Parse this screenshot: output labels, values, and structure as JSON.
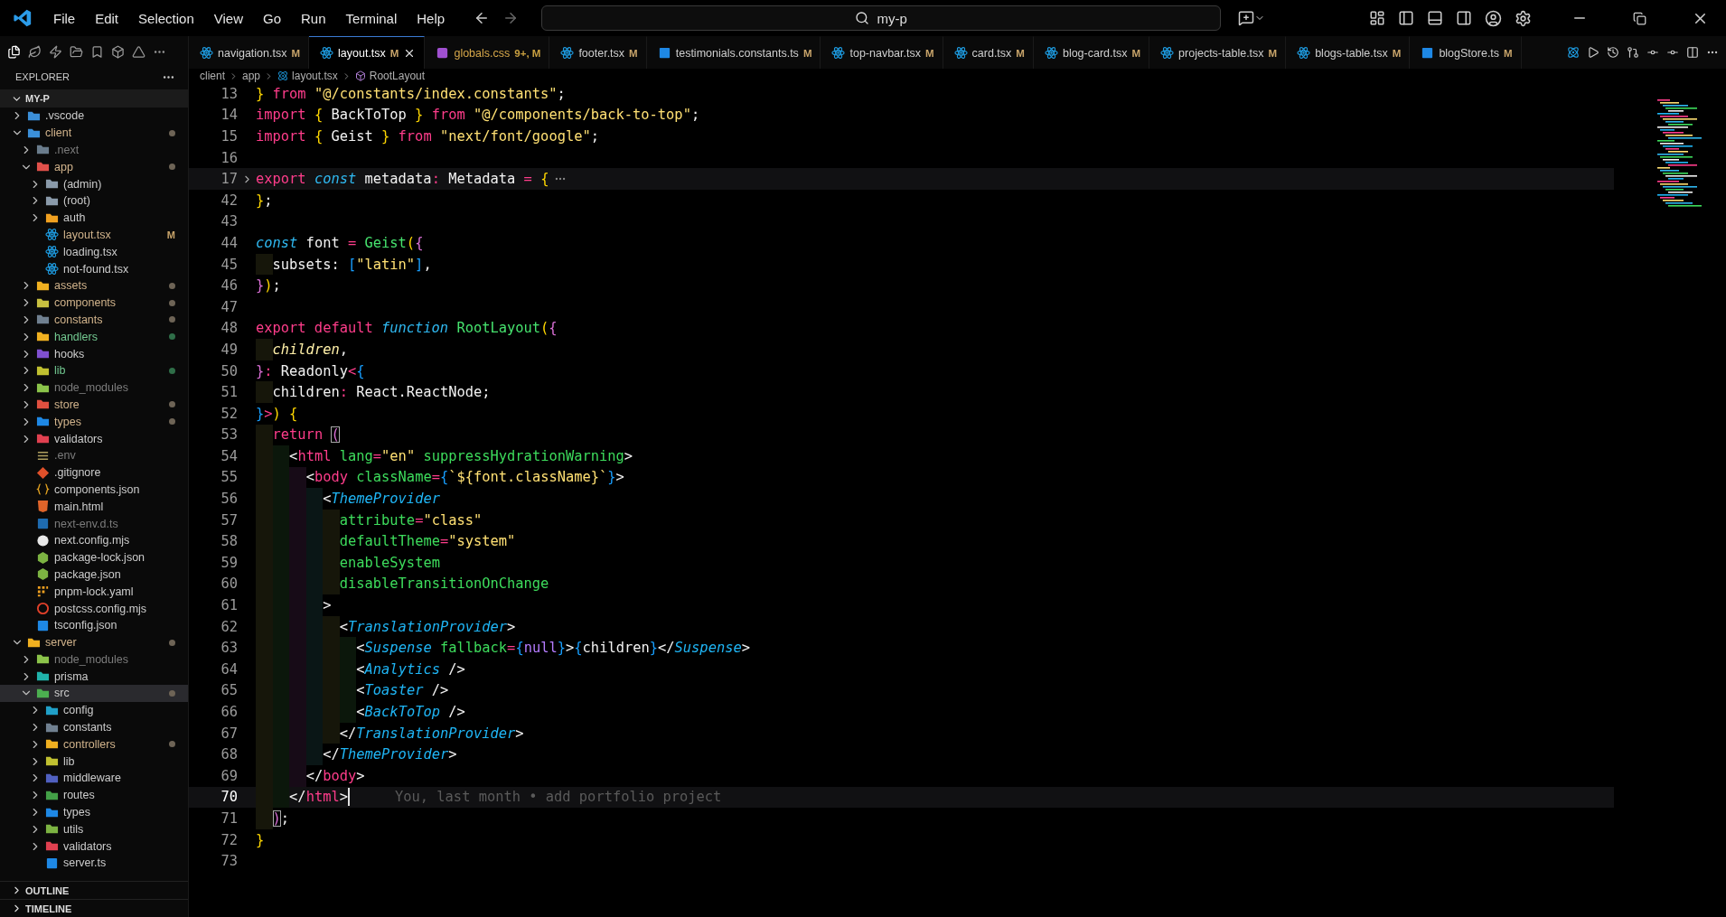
{
  "menu": [
    "File",
    "Edit",
    "Selection",
    "View",
    "Go",
    "Run",
    "Terminal",
    "Help"
  ],
  "search": {
    "value": "my-p"
  },
  "sidebar": {
    "title": "EXPLORER",
    "root": "MY-P",
    "tree": [
      {
        "name": ".vscode",
        "kind": "folder",
        "expanded": false,
        "modified": false,
        "untracked": false,
        "ignored": false,
        "dot": false,
        "color": "#3b8fd9",
        "selected": false
      },
      {
        "name": "client",
        "kind": "folder",
        "expanded": true,
        "modified": true,
        "untracked": false,
        "ignored": false,
        "dot": true,
        "color": "#3b8fd9",
        "selected": false,
        "children": [
          {
            "name": ".next",
            "kind": "folder",
            "expanded": false,
            "modified": false,
            "untracked": false,
            "ignored": true,
            "dot": false,
            "color": "#6a7c8c",
            "selected": false
          },
          {
            "name": "app",
            "kind": "folder",
            "expanded": true,
            "modified": true,
            "untracked": false,
            "ignored": false,
            "dot": true,
            "color": "#e0504a",
            "selected": false,
            "children": [
              {
                "name": "(admin)",
                "kind": "folder",
                "expanded": false,
                "modified": false,
                "untracked": false,
                "ignored": false,
                "dot": false,
                "color": "#8a9aaa",
                "selected": false
              },
              {
                "name": "(root)",
                "kind": "folder",
                "expanded": false,
                "modified": false,
                "untracked": false,
                "ignored": false,
                "dot": false,
                "color": "#8a9aaa",
                "selected": false
              },
              {
                "name": "auth",
                "kind": "folder",
                "expanded": false,
                "modified": false,
                "untracked": false,
                "ignored": false,
                "dot": false,
                "color": "#f0a020",
                "selected": false
              },
              {
                "name": "layout.tsx",
                "kind": "react",
                "badge": "M",
                "modified": true,
                "untracked": false,
                "ignored": false,
                "dot": false,
                "color": "#1e9be0",
                "selected": false
              },
              {
                "name": "loading.tsx",
                "kind": "react",
                "modified": false,
                "untracked": false,
                "ignored": false,
                "dot": false,
                "color": "#1e9be0",
                "selected": false
              },
              {
                "name": "not-found.tsx",
                "kind": "react",
                "modified": false,
                "untracked": false,
                "ignored": false,
                "dot": false,
                "color": "#1e9be0",
                "selected": false
              }
            ]
          },
          {
            "name": "assets",
            "kind": "folder",
            "expanded": false,
            "modified": true,
            "untracked": false,
            "ignored": false,
            "dot": true,
            "color": "#f0b020",
            "selected": false
          },
          {
            "name": "components",
            "kind": "folder",
            "expanded": false,
            "modified": true,
            "untracked": false,
            "ignored": false,
            "dot": true,
            "color": "#c8c040",
            "selected": false
          },
          {
            "name": "constants",
            "kind": "folder",
            "expanded": false,
            "modified": true,
            "untracked": false,
            "ignored": false,
            "dot": true,
            "color": "#708090",
            "selected": false
          },
          {
            "name": "handlers",
            "kind": "folder",
            "expanded": false,
            "modified": false,
            "untracked": true,
            "ignored": false,
            "dot": true,
            "color": "#f0b020",
            "selected": false
          },
          {
            "name": "hooks",
            "kind": "folder",
            "expanded": false,
            "modified": false,
            "untracked": false,
            "ignored": false,
            "dot": false,
            "color": "#8050d0",
            "selected": false
          },
          {
            "name": "lib",
            "kind": "folder",
            "expanded": false,
            "modified": false,
            "untracked": true,
            "ignored": false,
            "dot": true,
            "color": "#c0c030",
            "selected": false
          },
          {
            "name": "node_modules",
            "kind": "folder",
            "expanded": false,
            "modified": false,
            "untracked": false,
            "ignored": true,
            "dot": false,
            "color": "#8bc34a",
            "selected": false
          },
          {
            "name": "store",
            "kind": "folder",
            "expanded": false,
            "modified": true,
            "untracked": false,
            "ignored": false,
            "dot": true,
            "color": "#e05040",
            "selected": false
          },
          {
            "name": "types",
            "kind": "folder",
            "expanded": false,
            "modified": true,
            "untracked": false,
            "ignored": false,
            "dot": true,
            "color": "#1e88e5",
            "selected": false
          },
          {
            "name": "validators",
            "kind": "folder",
            "expanded": false,
            "modified": false,
            "untracked": false,
            "ignored": false,
            "dot": false,
            "color": "#e04050",
            "selected": false
          },
          {
            "name": ".env",
            "kind": "settings",
            "modified": false,
            "untracked": false,
            "ignored": true,
            "dot": false,
            "color": "#b0a060",
            "selected": false
          },
          {
            "name": ".gitignore",
            "kind": "git",
            "modified": false,
            "untracked": false,
            "ignored": false,
            "dot": false,
            "color": "#e0502a",
            "selected": false
          },
          {
            "name": "components.json",
            "kind": "json",
            "modified": false,
            "untracked": false,
            "ignored": false,
            "dot": false,
            "color": "#e0a020",
            "selected": false
          },
          {
            "name": "main.html",
            "kind": "html",
            "modified": false,
            "untracked": false,
            "ignored": false,
            "dot": false,
            "color": "#e0642a",
            "selected": false
          },
          {
            "name": "next-env.d.ts",
            "kind": "typescript",
            "modified": false,
            "untracked": false,
            "ignored": true,
            "dot": false,
            "color": "#1e6bb0",
            "selected": false
          },
          {
            "name": "next.config.mjs",
            "kind": "next",
            "modified": false,
            "untracked": false,
            "ignored": false,
            "dot": false,
            "color": "#e8e8e8",
            "selected": false
          },
          {
            "name": "package-lock.json",
            "kind": "node",
            "modified": false,
            "untracked": false,
            "ignored": false,
            "dot": false,
            "color": "#7cb342",
            "selected": false
          },
          {
            "name": "package.json",
            "kind": "node",
            "modified": false,
            "untracked": false,
            "ignored": false,
            "dot": false,
            "color": "#7cb342",
            "selected": false
          },
          {
            "name": "pnpm-lock.yaml",
            "kind": "grid",
            "modified": false,
            "untracked": false,
            "ignored": false,
            "dot": false,
            "color": "#f0a020",
            "selected": false
          },
          {
            "name": "postcss.config.mjs",
            "kind": "postcss",
            "modified": false,
            "untracked": false,
            "ignored": false,
            "dot": false,
            "color": "#e0402a",
            "selected": false
          },
          {
            "name": "tsconfig.json",
            "kind": "typescript",
            "modified": false,
            "untracked": false,
            "ignored": false,
            "dot": false,
            "color": "#1e88e5",
            "selected": false
          }
        ]
      },
      {
        "name": "server",
        "kind": "folder",
        "expanded": true,
        "modified": true,
        "untracked": false,
        "ignored": false,
        "dot": true,
        "color": "#f0b020",
        "selected": false,
        "children": [
          {
            "name": "node_modules",
            "kind": "folder",
            "expanded": false,
            "modified": false,
            "untracked": false,
            "ignored": true,
            "dot": false,
            "color": "#8bc34a",
            "selected": false
          },
          {
            "name": "prisma",
            "kind": "folder",
            "expanded": false,
            "modified": false,
            "untracked": false,
            "ignored": false,
            "dot": false,
            "color": "#20b2aa",
            "selected": false
          },
          {
            "name": "src",
            "kind": "folder",
            "expanded": true,
            "modified": false,
            "untracked": false,
            "ignored": false,
            "dot": true,
            "color": "#4caf50",
            "selected": true,
            "children": [
              {
                "name": "config",
                "kind": "folder",
                "expanded": false,
                "modified": false,
                "untracked": false,
                "ignored": false,
                "dot": false,
                "color": "#20a0c8",
                "selected": false
              },
              {
                "name": "constants",
                "kind": "folder",
                "expanded": false,
                "modified": false,
                "untracked": false,
                "ignored": false,
                "dot": false,
                "color": "#708090",
                "selected": false
              },
              {
                "name": "controllers",
                "kind": "folder",
                "expanded": false,
                "modified": true,
                "untracked": false,
                "ignored": false,
                "dot": true,
                "color": "#f0b020",
                "selected": false
              },
              {
                "name": "lib",
                "kind": "folder",
                "expanded": false,
                "modified": false,
                "untracked": false,
                "ignored": false,
                "dot": false,
                "color": "#c0c030",
                "selected": false
              },
              {
                "name": "middleware",
                "kind": "folder",
                "expanded": false,
                "modified": false,
                "untracked": false,
                "ignored": false,
                "dot": false,
                "color": "#5060c0",
                "selected": false
              },
              {
                "name": "routes",
                "kind": "folder",
                "expanded": false,
                "modified": false,
                "untracked": false,
                "ignored": false,
                "dot": false,
                "color": "#43a047",
                "selected": false
              },
              {
                "name": "types",
                "kind": "folder",
                "expanded": false,
                "modified": false,
                "untracked": false,
                "ignored": false,
                "dot": false,
                "color": "#1e88e5",
                "selected": false
              },
              {
                "name": "utils",
                "kind": "folder",
                "expanded": false,
                "modified": false,
                "untracked": false,
                "ignored": false,
                "dot": false,
                "color": "#7cb342",
                "selected": false
              },
              {
                "name": "validators",
                "kind": "folder",
                "expanded": false,
                "modified": false,
                "untracked": false,
                "ignored": false,
                "dot": false,
                "color": "#e04050",
                "selected": false
              },
              {
                "name": "server.ts",
                "kind": "typescript",
                "modified": false,
                "untracked": false,
                "ignored": false,
                "dot": false,
                "color": "#1e88e5",
                "selected": false
              }
            ]
          }
        ]
      }
    ],
    "panels": [
      "OUTLINE",
      "TIMELINE"
    ]
  },
  "tabs": [
    {
      "label": "navigation.tsx",
      "status": "M",
      "kind": "react",
      "problem": false,
      "selected": false
    },
    {
      "label": "layout.tsx",
      "status": "M",
      "kind": "react",
      "problem": false,
      "selected": true
    },
    {
      "label": "globals.css",
      "status": "9+, M",
      "kind": "css",
      "problem": true,
      "selected": false
    },
    {
      "label": "footer.tsx",
      "status": "M",
      "kind": "react",
      "problem": false,
      "selected": false
    },
    {
      "label": "testimonials.constants.ts",
      "status": "M",
      "kind": "typescript",
      "problem": false,
      "selected": false
    },
    {
      "label": "top-navbar.tsx",
      "status": "M",
      "kind": "react",
      "problem": false,
      "selected": false
    },
    {
      "label": "card.tsx",
      "status": "M",
      "kind": "react",
      "problem": false,
      "selected": false
    },
    {
      "label": "blog-card.tsx",
      "status": "M",
      "kind": "react",
      "problem": false,
      "selected": false
    },
    {
      "label": "projects-table.tsx",
      "status": "M",
      "kind": "react",
      "problem": false,
      "selected": false
    },
    {
      "label": "blogs-table.tsx",
      "status": "M",
      "kind": "react",
      "problem": false,
      "selected": false
    },
    {
      "label": "blogStore.ts",
      "status": "M",
      "kind": "typescript",
      "problem": false,
      "selected": false
    }
  ],
  "breadcrumb": [
    {
      "label": "client",
      "kind": "folder"
    },
    {
      "label": "app",
      "kind": "folder"
    },
    {
      "label": "layout.tsx",
      "kind": "file"
    },
    {
      "label": "RootLayout",
      "kind": "symbol"
    }
  ],
  "code": [
    {
      "number": "13",
      "tokens": [
        {
          "kind": "brace1",
          "text": "}"
        },
        {
          "kind": "keyword",
          "text": " from "
        },
        {
          "kind": "string",
          "text": "\"@/constants/index.constants\""
        },
        {
          "kind": "plain",
          "text": ";"
        }
      ]
    },
    {
      "number": "14",
      "tokens": [
        {
          "kind": "keyword",
          "text": "import "
        },
        {
          "kind": "brace1",
          "text": "{"
        },
        {
          "kind": "plain",
          "text": " BackToTop "
        },
        {
          "kind": "brace1",
          "text": "}"
        },
        {
          "kind": "keyword",
          "text": " from "
        },
        {
          "kind": "string",
          "text": "\"@/components/back-to-top\""
        },
        {
          "kind": "plain",
          "text": ";"
        }
      ]
    },
    {
      "number": "15",
      "tokens": [
        {
          "kind": "keyword",
          "text": "import "
        },
        {
          "kind": "brace1",
          "text": "{"
        },
        {
          "kind": "plain",
          "text": " Geist "
        },
        {
          "kind": "brace1",
          "text": "}"
        },
        {
          "kind": "keyword",
          "text": " from "
        },
        {
          "kind": "string",
          "text": "\"next/font/google\""
        },
        {
          "kind": "plain",
          "text": ";"
        }
      ]
    },
    {
      "number": "16"
    },
    {
      "number": "17",
      "folded": true,
      "tokens": [
        {
          "kind": "keyword",
          "text": "export "
        },
        {
          "kind": "storage",
          "text": "const"
        },
        {
          "kind": "plain",
          "text": " metadata"
        },
        {
          "kind": "operator",
          "text": ":"
        },
        {
          "kind": "plain",
          "text": " Metadata "
        },
        {
          "kind": "operator",
          "text": "= "
        },
        {
          "kind": "brace1",
          "text": "{"
        }
      ]
    },
    {
      "number": "42",
      "tokens": [
        {
          "kind": "brace1",
          "text": "}"
        },
        {
          "kind": "plain",
          "text": ";"
        }
      ]
    },
    {
      "number": "43"
    },
    {
      "number": "44",
      "tokens": [
        {
          "kind": "storage",
          "text": "const"
        },
        {
          "kind": "plain",
          "text": " font "
        },
        {
          "kind": "operator",
          "text": "= "
        },
        {
          "kind": "function",
          "text": "Geist"
        },
        {
          "kind": "brace1",
          "text": "("
        },
        {
          "kind": "brace2",
          "text": "{"
        }
      ]
    },
    {
      "number": "45",
      "tokens": [
        {
          "kind": "plain",
          "text": "  subsets: "
        },
        {
          "kind": "brace3",
          "text": "["
        },
        {
          "kind": "string",
          "text": "\"latin\""
        },
        {
          "kind": "brace3",
          "text": "]"
        },
        {
          "kind": "plain",
          "text": ","
        }
      ]
    },
    {
      "number": "46",
      "tokens": [
        {
          "kind": "brace2",
          "text": "}"
        },
        {
          "kind": "brace1",
          "text": ")"
        },
        {
          "kind": "plain",
          "text": ";"
        }
      ]
    },
    {
      "number": "47"
    },
    {
      "number": "48",
      "tokens": [
        {
          "kind": "keyword",
          "text": "export default "
        },
        {
          "kind": "storage",
          "text": "function"
        },
        {
          "kind": "function",
          "text": " RootLayout"
        },
        {
          "kind": "brace1",
          "text": "("
        },
        {
          "kind": "brace2",
          "text": "{"
        }
      ]
    },
    {
      "number": "49",
      "tokens": [
        {
          "kind": "parameter",
          "text": "  children"
        },
        {
          "kind": "plain",
          "text": ","
        }
      ]
    },
    {
      "number": "50",
      "tokens": [
        {
          "kind": "brace2",
          "text": "}"
        },
        {
          "kind": "operator",
          "text": ":"
        },
        {
          "kind": "plain",
          "text": " Readonly"
        },
        {
          "kind": "operator",
          "text": "<"
        },
        {
          "kind": "brace3",
          "text": "{"
        }
      ]
    },
    {
      "number": "51",
      "tokens": [
        {
          "kind": "plain",
          "text": "  children"
        },
        {
          "kind": "operator",
          "text": ":"
        },
        {
          "kind": "plain",
          "text": " React.ReactNode;"
        }
      ]
    },
    {
      "number": "52",
      "tokens": [
        {
          "kind": "brace3",
          "text": "}"
        },
        {
          "kind": "operator",
          "text": ">"
        },
        {
          "kind": "brace1",
          "text": ")"
        },
        {
          "kind": "brace1",
          "text": " {"
        }
      ]
    },
    {
      "number": "53",
      "tokens": [
        {
          "kind": "keyword",
          "text": "  return "
        },
        {
          "kind": "matched",
          "text": "("
        }
      ]
    },
    {
      "number": "54",
      "tokens": [
        {
          "kind": "plain",
          "text": "    <"
        },
        {
          "kind": "tag",
          "text": "html"
        },
        {
          "kind": "attribute",
          "text": " lang"
        },
        {
          "kind": "operator",
          "text": "="
        },
        {
          "kind": "string",
          "text": "\"en\""
        },
        {
          "kind": "attribute",
          "text": " suppressHydrationWarning"
        },
        {
          "kind": "plain",
          "text": ">"
        }
      ]
    },
    {
      "number": "55",
      "tokens": [
        {
          "kind": "plain",
          "text": "      <"
        },
        {
          "kind": "tag",
          "text": "body"
        },
        {
          "kind": "attribute",
          "text": " className"
        },
        {
          "kind": "operator",
          "text": "="
        },
        {
          "kind": "brace3",
          "text": "{"
        },
        {
          "kind": "string",
          "text": "`${font.className}`"
        },
        {
          "kind": "brace3",
          "text": "}"
        },
        {
          "kind": "plain",
          "text": ">"
        }
      ]
    },
    {
      "number": "56",
      "tokens": [
        {
          "kind": "plain",
          "text": "        <"
        },
        {
          "kind": "component",
          "text": "ThemeProvider"
        }
      ]
    },
    {
      "number": "57",
      "tokens": [
        {
          "kind": "attribute",
          "text": "          attribute"
        },
        {
          "kind": "operator",
          "text": "="
        },
        {
          "kind": "string",
          "text": "\"class\""
        }
      ]
    },
    {
      "number": "58",
      "tokens": [
        {
          "kind": "attribute",
          "text": "          defaultTheme"
        },
        {
          "kind": "operator",
          "text": "="
        },
        {
          "kind": "string",
          "text": "\"system\""
        }
      ]
    },
    {
      "number": "59",
      "tokens": [
        {
          "kind": "attribute",
          "text": "          enableSystem"
        }
      ]
    },
    {
      "number": "60",
      "tokens": [
        {
          "kind": "attribute",
          "text": "          disableTransitionOnChange"
        }
      ]
    },
    {
      "number": "61",
      "tokens": [
        {
          "kind": "plain",
          "text": "        >"
        }
      ]
    },
    {
      "number": "62",
      "tokens": [
        {
          "kind": "plain",
          "text": "          <"
        },
        {
          "kind": "component",
          "text": "TranslationProvider"
        },
        {
          "kind": "plain",
          "text": ">"
        }
      ]
    },
    {
      "number": "63",
      "tokens": [
        {
          "kind": "plain",
          "text": "            <"
        },
        {
          "kind": "component",
          "text": "Suspense"
        },
        {
          "kind": "attribute",
          "text": " fallback"
        },
        {
          "kind": "operator",
          "text": "="
        },
        {
          "kind": "brace3",
          "text": "{"
        },
        {
          "kind": "constant",
          "text": "null"
        },
        {
          "kind": "brace3",
          "text": "}"
        },
        {
          "kind": "plain",
          "text": ">"
        },
        {
          "kind": "brace3",
          "text": "{"
        },
        {
          "kind": "plain",
          "text": "children"
        },
        {
          "kind": "brace3",
          "text": "}"
        },
        {
          "kind": "plain",
          "text": "</"
        },
        {
          "kind": "component",
          "text": "Suspense"
        },
        {
          "kind": "plain",
          "text": ">"
        }
      ]
    },
    {
      "number": "64",
      "tokens": [
        {
          "kind": "plain",
          "text": "            <"
        },
        {
          "kind": "component",
          "text": "Analytics"
        },
        {
          "kind": "plain",
          "text": " />"
        }
      ]
    },
    {
      "number": "65",
      "tokens": [
        {
          "kind": "plain",
          "text": "            <"
        },
        {
          "kind": "component",
          "text": "Toaster"
        },
        {
          "kind": "plain",
          "text": " />"
        }
      ]
    },
    {
      "number": "66",
      "tokens": [
        {
          "kind": "plain",
          "text": "            <"
        },
        {
          "kind": "component",
          "text": "BackToTop"
        },
        {
          "kind": "plain",
          "text": " />"
        }
      ]
    },
    {
      "number": "67",
      "tokens": [
        {
          "kind": "plain",
          "text": "          </"
        },
        {
          "kind": "component",
          "text": "TranslationProvider"
        },
        {
          "kind": "plain",
          "text": ">"
        }
      ]
    },
    {
      "number": "68",
      "tokens": [
        {
          "kind": "plain",
          "text": "        </"
        },
        {
          "kind": "component",
          "text": "ThemeProvider"
        },
        {
          "kind": "plain",
          "text": ">"
        }
      ]
    },
    {
      "number": "69",
      "tokens": [
        {
          "kind": "plain",
          "text": "      </"
        },
        {
          "kind": "tag",
          "text": "body"
        },
        {
          "kind": "plain",
          "text": ">"
        }
      ]
    },
    {
      "number": "70",
      "active": true,
      "blame": "You, last month • add portfolio project",
      "tokens": [
        {
          "kind": "plain",
          "text": "    </"
        },
        {
          "kind": "tag",
          "text": "html"
        },
        {
          "kind": "plain",
          "text": ">"
        }
      ]
    },
    {
      "number": "71",
      "tokens": [
        {
          "kind": "matched",
          "text": "  )"
        },
        {
          "kind": "plain",
          "text": ";"
        }
      ]
    },
    {
      "number": "72",
      "tokens": [
        {
          "kind": "brace1",
          "text": "}"
        }
      ]
    },
    {
      "number": "73"
    }
  ]
}
